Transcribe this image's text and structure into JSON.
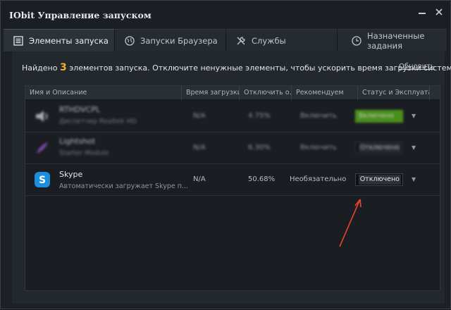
{
  "window": {
    "title": "IObit Управление запуском"
  },
  "tabs": [
    {
      "label": "Элементы запуска",
      "icon": "list-icon",
      "active": true
    },
    {
      "label": "Запуски Браузера",
      "icon": "globe-icon",
      "active": false
    },
    {
      "label": "Службы",
      "icon": "tools-icon",
      "active": false
    },
    {
      "label": "Назначенные задания",
      "icon": "clock-icon",
      "active": false
    }
  ],
  "info": {
    "prefix": "Найдено",
    "count": "3",
    "suffix": "элементов запуска. Отключите ненужные элементы, чтобы ускорить время загрузки системы.",
    "refresh": "Обновить"
  },
  "table": {
    "columns": [
      "Имя и Описание",
      "Время загрузки",
      "Отключить о...",
      "Рекомендуем",
      "Статус и Эксплуата..."
    ],
    "rows": [
      {
        "name": "RTHDVCPL",
        "desc": "Диспетчер Realtek HD",
        "load_time": "N/A",
        "disable_pct": "4.75%",
        "recommend": "Включить",
        "status": "Включено",
        "enabled": true,
        "icon": "speaker-icon",
        "blurred": true
      },
      {
        "name": "Lightshot",
        "desc": "Starter Module",
        "load_time": "N/A",
        "disable_pct": "6.30%",
        "recommend": "Включить",
        "status": "Отключено",
        "enabled": false,
        "icon": "feather-icon",
        "blurred": true
      },
      {
        "name": "Skype",
        "desc": "Автоматически загружает Skype п...",
        "load_time": "N/A",
        "disable_pct": "50.68%",
        "recommend": "Необязательно",
        "status": "Отключено",
        "enabled": false,
        "icon": "skype-icon",
        "blurred": false
      }
    ]
  },
  "colors": {
    "accent_count": "#f0b030",
    "status_on": "#58b518",
    "arrow": "#e8452a"
  }
}
